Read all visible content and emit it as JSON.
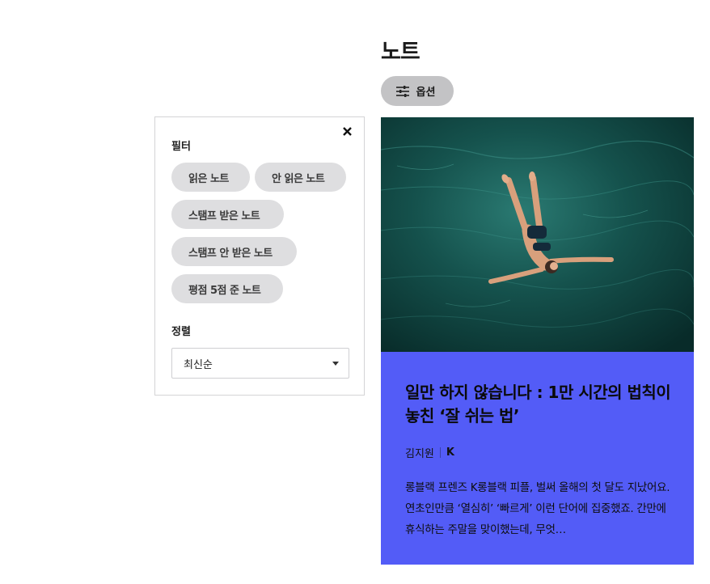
{
  "page": {
    "title": "노트"
  },
  "options_button": {
    "label": "옵션",
    "icon": "sliders-icon"
  },
  "filter_panel": {
    "close_icon": "close-icon",
    "filter_label": "필터",
    "filters": [
      "읽은 노트",
      "안 읽은 노트",
      "스탬프 받은 노트",
      "스탬프 안 받은 노트",
      "평점 5점 준 노트"
    ],
    "sort_label": "정렬",
    "sort_value": "최신순"
  },
  "card": {
    "title": "일만 하지 않습니다 : 1만 시간의 법칙이 놓친 ‘잘 쉬는 법’",
    "author": "김지원",
    "publisher": "K",
    "excerpt": "롱블랙 프렌즈 K롱블랙 피플, 벌써 올해의 첫 달도 지났어요. 연초인만큼 ‘열심히’ ‘빠르게’ 이런 단어에 집중했죠. 간만에 휴식하는 주말을 맞이했는데, 무엇…",
    "body_color": "#535cf7"
  }
}
